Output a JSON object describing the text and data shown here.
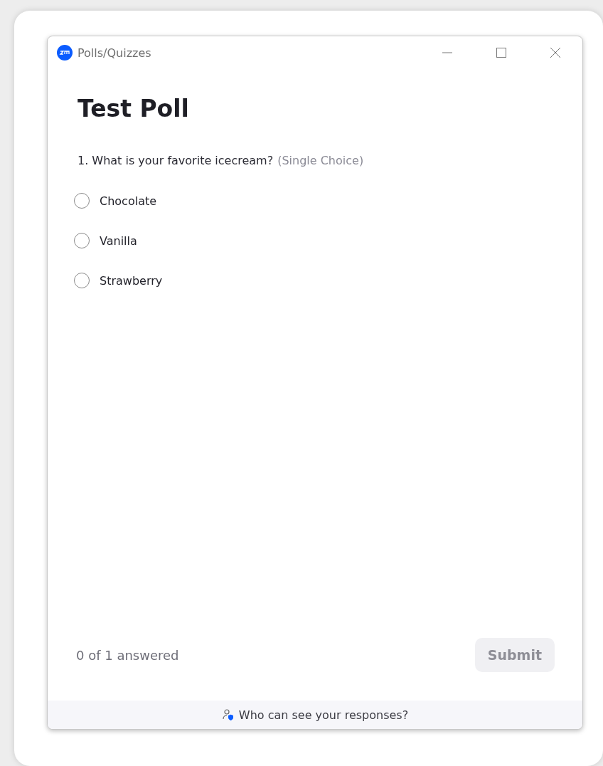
{
  "window": {
    "title": "Polls/Quizzes"
  },
  "poll": {
    "title": "Test Poll"
  },
  "question": {
    "text": "1. What is your favorite icecream?",
    "type_note": "(Single Choice)",
    "options": [
      {
        "label": "Chocolate",
        "selected": false
      },
      {
        "label": "Vanilla",
        "selected": false
      },
      {
        "label": "Strawberry",
        "selected": false
      }
    ]
  },
  "footer": {
    "progress": "0 of 1 answered",
    "submit": {
      "label": "Submit",
      "disabled": true
    }
  },
  "privacy_link": "Who can see your responses?"
}
